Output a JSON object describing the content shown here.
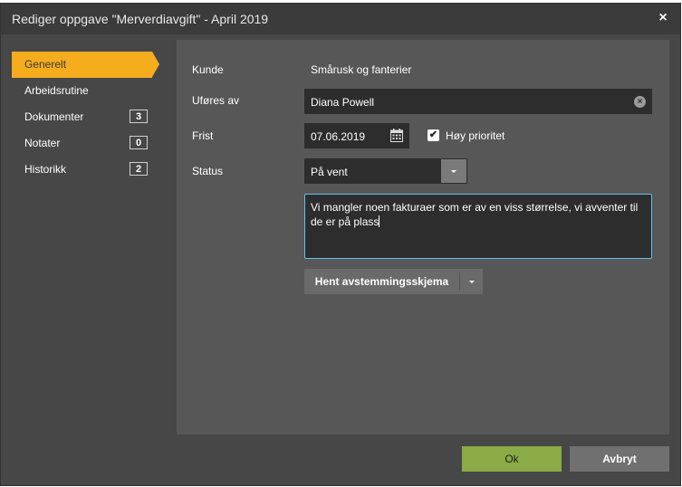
{
  "dialog": {
    "title": "Rediger oppgave \"Merverdiavgift\" - April 2019",
    "close_glyph": "×"
  },
  "nav": {
    "items": [
      {
        "label": "Generelt",
        "active": true
      },
      {
        "label": "Arbeidsrutine"
      },
      {
        "label": "Dokumenter",
        "count": "3"
      },
      {
        "label": "Notater",
        "count": "0"
      },
      {
        "label": "Historikk",
        "count": "2"
      }
    ]
  },
  "form": {
    "kunde_label": "Kunde",
    "kunde_value": "Smårusk og fanterier",
    "utfores_label": "Uføres av",
    "utfores_value": "Diana Powell",
    "frist_label": "Frist",
    "frist_value": "07.06.2019",
    "priority_label": "Høy prioritet",
    "priority_checked": true,
    "status_label": "Status",
    "status_value": "På vent",
    "note": "Vi mangler noen fakturaer som er av en viss størrelse, vi avventer til de er på plass"
  },
  "actions": {
    "fetch_label": "Hent avstemmingsskjema",
    "ok_label": "Ok",
    "cancel_label": "Avbryt"
  },
  "colors": {
    "accent": "#f5ad1d",
    "ok": "#8aab46",
    "focus": "#5ec0f0"
  },
  "icons": {
    "close": "close-icon",
    "clear": "clear-icon",
    "calendar": "calendar-icon",
    "check": "checkmark-icon",
    "dropdown": "chevron-down-icon"
  }
}
